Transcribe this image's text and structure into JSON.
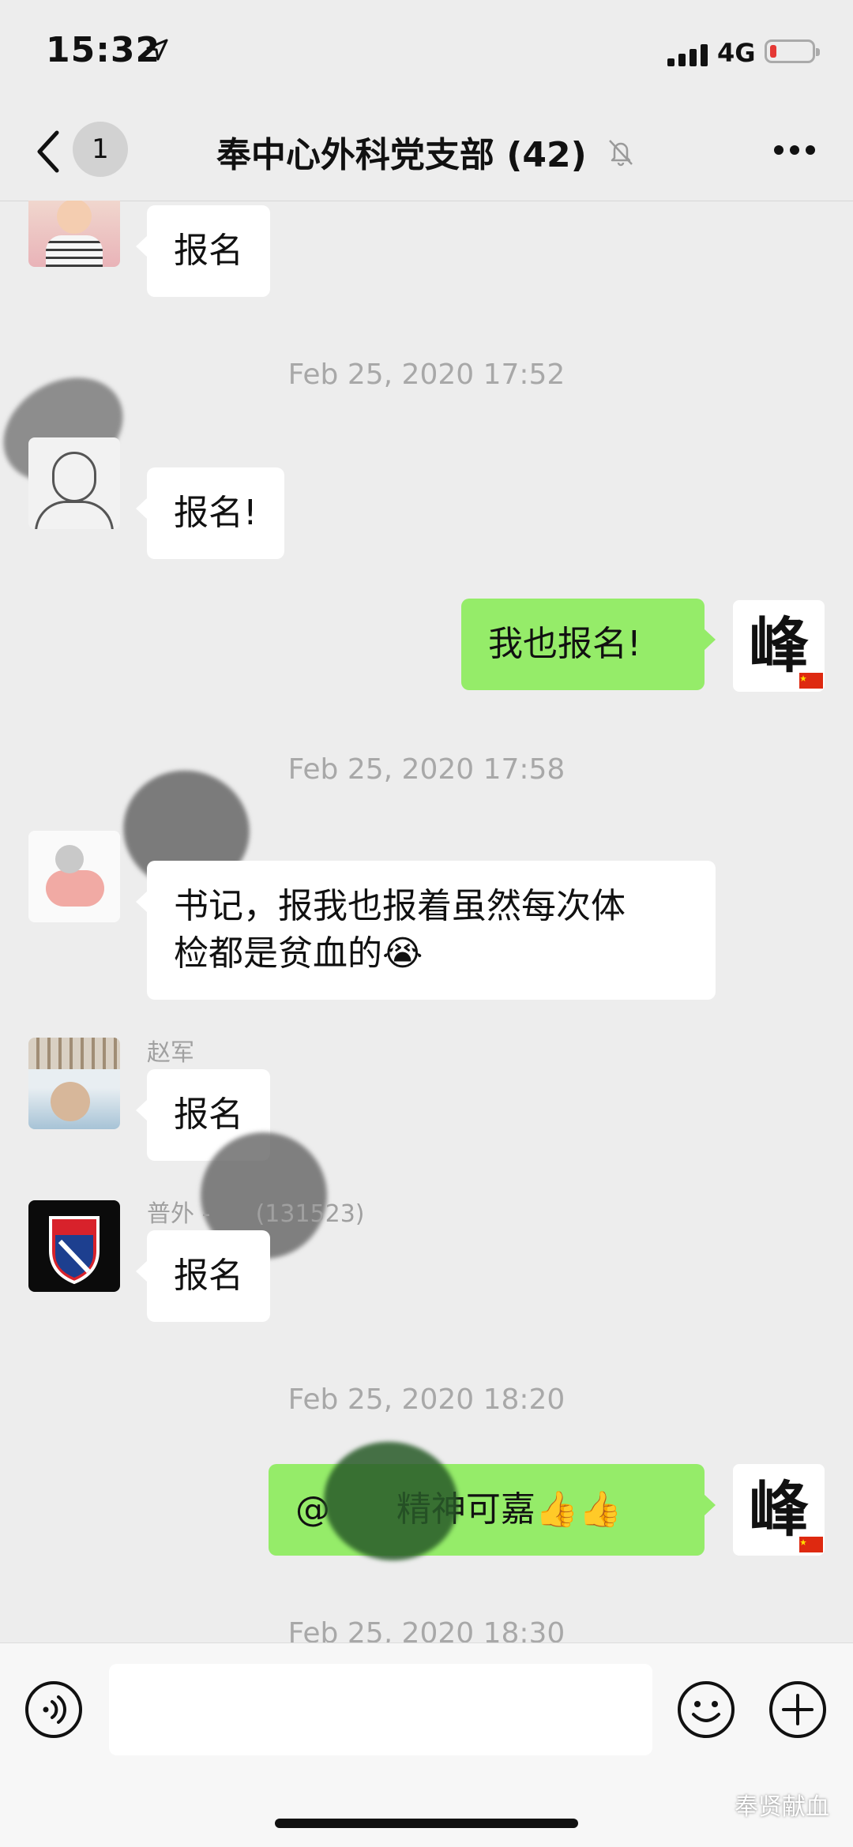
{
  "status": {
    "time": "15:32",
    "network": "4G"
  },
  "header": {
    "back_count": "1",
    "title": "奉中心外科党支部 (42)"
  },
  "messages": [
    {
      "text": "报名"
    },
    {
      "timestamp": "Feb 25, 2020 17:52"
    },
    {
      "text": "报名!"
    },
    {
      "text": "我也报名!",
      "avatar_text": "峰"
    },
    {
      "timestamp": "Feb 25, 2020 17:58"
    },
    {
      "text": "书记，报我也报着虽然每次体\n检都是贫血的😭"
    },
    {
      "name": "赵军",
      "text": "报名"
    },
    {
      "name": "普外 -      (131523)",
      "text": "报名"
    },
    {
      "timestamp": "Feb 25, 2020 18:20"
    },
    {
      "text": "@      精神可嘉👍👍",
      "avatar_text": "峰"
    },
    {
      "timestamp": "Feb 25, 2020 18:30"
    }
  ],
  "watermark": "奉贤献血",
  "colors": {
    "background": "#ededed",
    "outgoing_bubble": "#95ec69",
    "incoming_bubble": "#ffffff"
  }
}
